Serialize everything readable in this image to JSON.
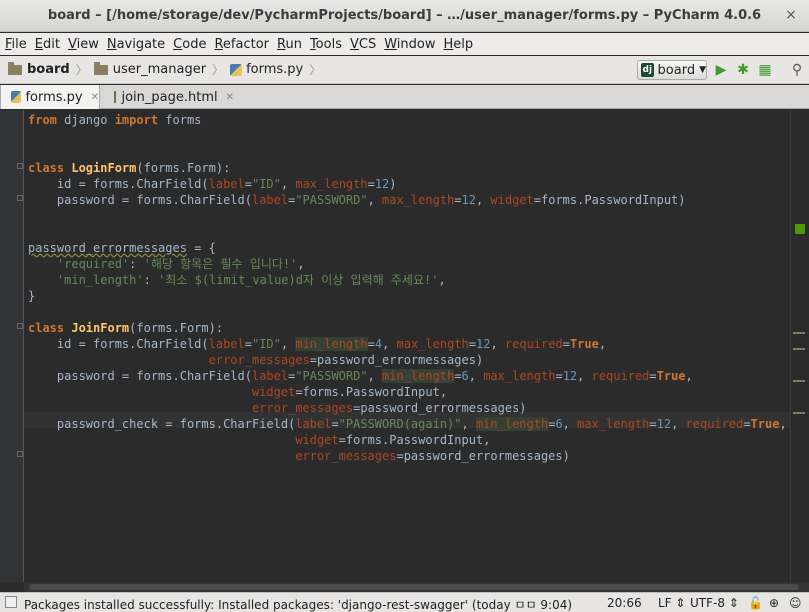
{
  "window": {
    "title": "board – [/home/storage/dev/PycharmProjects/board] – …/user_manager/forms.py – PyCharm 4.0.6",
    "close": "×"
  },
  "menu": [
    "File",
    "Edit",
    "View",
    "Navigate",
    "Code",
    "Refactor",
    "Run",
    "Tools",
    "VCS",
    "Window",
    "Help"
  ],
  "breadcrumb": [
    "board",
    "user_manager",
    "forms.py"
  ],
  "run_config": {
    "label": "board",
    "badge": "dj"
  },
  "tabs": [
    {
      "label": "forms.py",
      "active": true
    },
    {
      "label": "join_page.html",
      "active": false
    }
  ],
  "code_lines": [
    "from django import forms",
    "",
    "",
    "class LoginForm(forms.Form):",
    "    id = forms.CharField(label=\"ID\", max_length=12)",
    "    password = forms.CharField(label=\"PASSWORD\", max_length=12, widget=forms.PasswordInput)",
    "",
    "",
    "password_errormessages = {",
    "    'required': '해당 항목은 필수 입니다!',",
    "    'min_length': '최소 $(limit_value)d자 이상 입력해 주세요!',",
    "}",
    "",
    "class JoinForm(forms.Form):",
    "    id = forms.CharField(label=\"ID\", min_length=4, max_length=12, required=True,",
    "                         error_messages=password_errormessages)",
    "    password = forms.CharField(label=\"PASSWORD\", min_length=6, max_length=12, required=True,",
    "                               widget=forms.PasswordInput,",
    "                               error_messages=password_errormessages)",
    "    password_check = forms.CharField(label=\"PASSWORD(again)\", min_length=6, max_length=12, required=True,",
    "                                     widget=forms.PasswordInput,",
    "                                     error_messages=password_errormessages)"
  ],
  "status": {
    "message": "Packages installed successfully: Installed packages: 'django-rest-swagger' (today ㅁㅁ 9:04)",
    "position": "20:66",
    "line_sep": "LF ⇕",
    "encoding": "UTF-8 ⇕",
    "lock": "🔓",
    "ins": "⊕",
    "face": "☺"
  }
}
